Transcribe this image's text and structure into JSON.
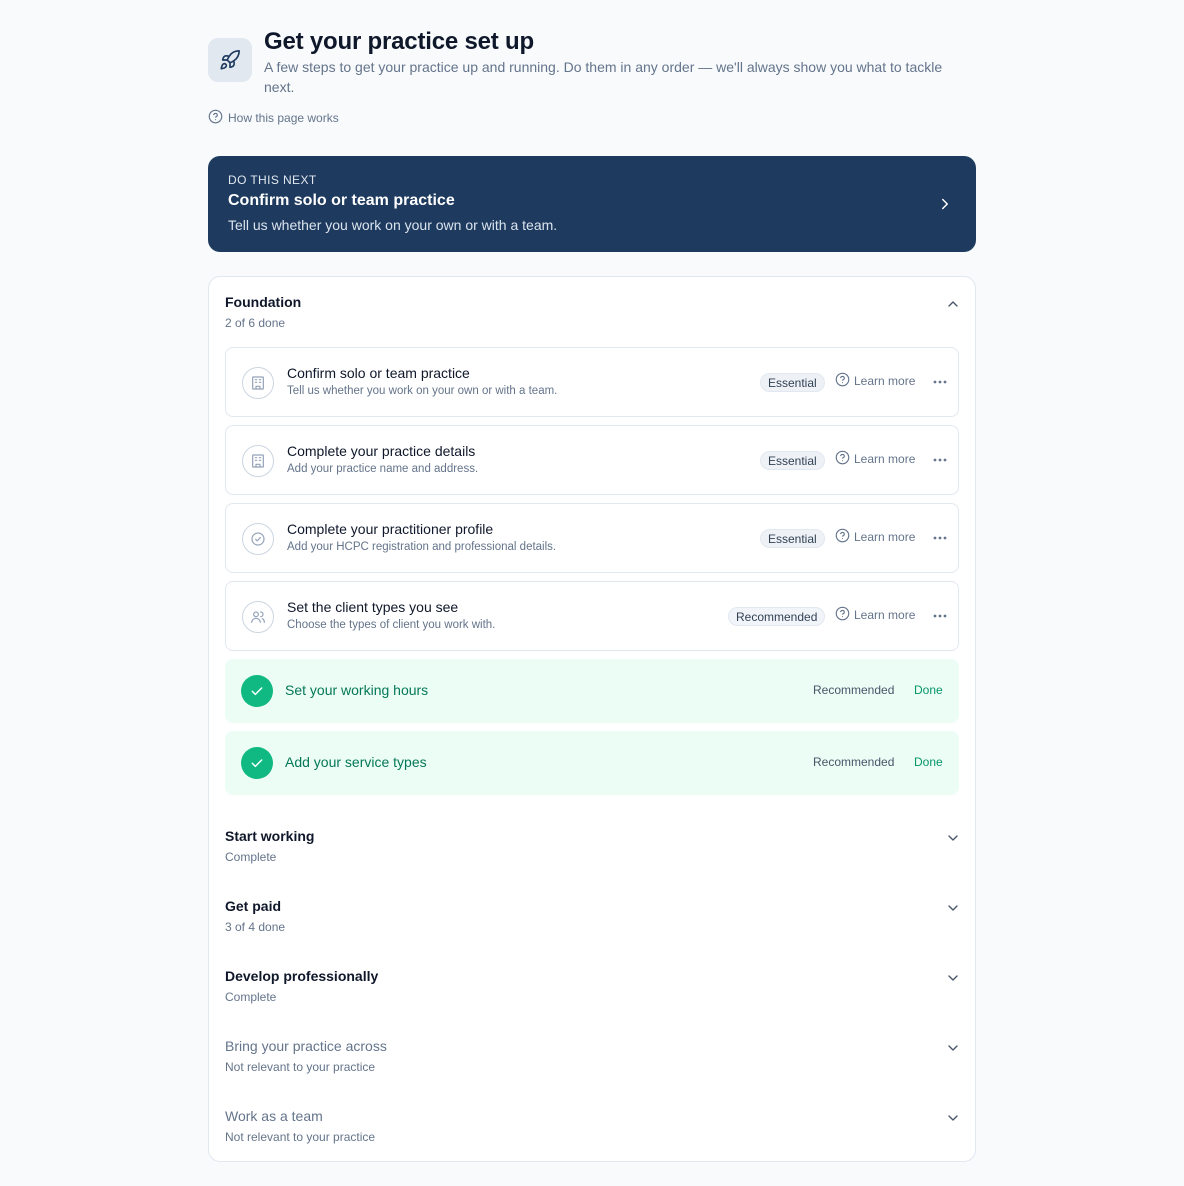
{
  "header": {
    "title": "Get your practice set up",
    "subtitle": "A few steps to get your practice up and running. Do them in any order — we'll always show you what to tackle next.",
    "help_link": "How this page works",
    "icon": "rocket-icon"
  },
  "next_card": {
    "eyebrow": "DO THIS NEXT",
    "title": "Confirm solo or team practice",
    "description": "Tell us whether you work on your own or with a team.",
    "background": "#1e3a5f"
  },
  "foundation": {
    "title": "Foundation",
    "progress": "2 of 6 done",
    "tasks": [
      {
        "title": "Confirm solo or team practice",
        "description": "Tell us whether you work on your own or with a team.",
        "badge": "Essential",
        "learn": "Learn more",
        "icon": "building-icon"
      },
      {
        "title": "Complete your practice details",
        "description": "Add your practice name and address.",
        "badge": "Essential",
        "learn": "Learn more",
        "icon": "building-icon"
      },
      {
        "title": "Complete your practitioner profile",
        "description": "Add your HCPC registration and professional details.",
        "badge": "Essential",
        "learn": "Learn more",
        "icon": "badge-check-icon"
      },
      {
        "title": "Set the client types you see",
        "description": "Choose the types of client you work with.",
        "badge": "Recommended",
        "learn": "Learn more",
        "icon": "users-icon"
      }
    ],
    "done": [
      {
        "title": "Set your working hours",
        "badge": "Recommended",
        "status": "Done"
      },
      {
        "title": "Add your service types",
        "badge": "Recommended",
        "status": "Done"
      }
    ]
  },
  "sections": [
    {
      "title": "Start working",
      "subtitle": "Complete"
    },
    {
      "title": "Get paid",
      "subtitle": "3 of 4 done"
    },
    {
      "title": "Develop professionally",
      "subtitle": "Complete"
    },
    {
      "title": "Bring your practice across",
      "subtitle": "Not relevant to your practice"
    },
    {
      "title": "Work as a team",
      "subtitle": "Not relevant to your practice"
    }
  ],
  "colors": {
    "accent_dark": "#1e3a5f",
    "success": "#10b981",
    "success_bg": "#ecfdf5"
  }
}
